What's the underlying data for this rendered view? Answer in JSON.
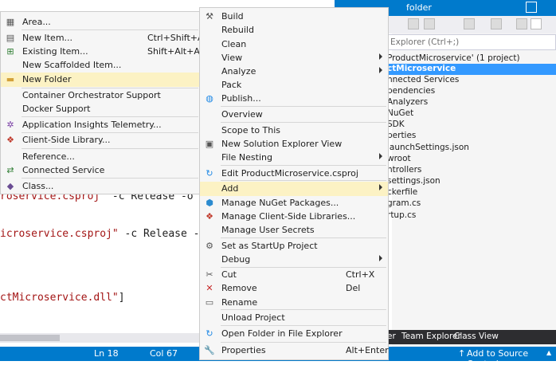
{
  "editor": {
    "lines": [
      {
        "str": "roservice.csproj\"",
        "rest": " -c Release -o /app"
      },
      {
        "str": "icroservice.csproj\"",
        "rest": " -c Release -o /app"
      },
      {
        "str": "ctMicroservice.dll\"",
        "rest": "]"
      }
    ]
  },
  "statusbar": {
    "line": "Ln 18",
    "col": "Col 67",
    "source_control": "Add to Source Control"
  },
  "solution_explorer": {
    "title": "folder",
    "search_placeholder": "Explorer (Ctrl+;)",
    "tree": [
      "ProductMicroservice' (1 project)",
      "ctMicroservice",
      "nnected Services",
      "pendencies",
      "Analyzers",
      "NuGet",
      "SDK",
      "perties",
      "launchSettings.json",
      "wroot",
      "ntrollers",
      "settings.json",
      "ckerfile",
      "gram.cs",
      "rtup.cs"
    ],
    "tabs": [
      "er",
      "Team Explorer",
      "Class View"
    ]
  },
  "add_menu": {
    "items": [
      {
        "label": "Area...",
        "shortcut": "",
        "icon": "area-icon"
      },
      {
        "label": "New Item...",
        "shortcut": "Ctrl+Shift+A",
        "icon": "new-item-icon"
      },
      {
        "label": "Existing Item...",
        "shortcut": "Shift+Alt+A",
        "icon": "existing-item-icon"
      },
      {
        "label": "New Scaffolded Item...",
        "shortcut": "",
        "icon": ""
      },
      {
        "label": "New Folder",
        "shortcut": "",
        "icon": "folder-icon"
      },
      {
        "label": "Container Orchestrator Support",
        "shortcut": "",
        "icon": ""
      },
      {
        "label": "Docker Support",
        "shortcut": "",
        "icon": ""
      },
      {
        "label": "Application Insights Telemetry...",
        "shortcut": "",
        "icon": "app-insights-icon"
      },
      {
        "label": "Client-Side Library...",
        "shortcut": "",
        "icon": "client-lib-icon"
      },
      {
        "label": "Reference...",
        "shortcut": "",
        "icon": ""
      },
      {
        "label": "Connected Service",
        "shortcut": "",
        "icon": "connected-service-icon"
      },
      {
        "label": "Class...",
        "shortcut": "",
        "icon": "class-icon"
      }
    ]
  },
  "project_menu": {
    "items": [
      {
        "label": "Build",
        "shortcut": ""
      },
      {
        "label": "Rebuild",
        "shortcut": ""
      },
      {
        "label": "Clean",
        "shortcut": ""
      },
      {
        "label": "View",
        "shortcut": ""
      },
      {
        "label": "Analyze",
        "shortcut": ""
      },
      {
        "label": "Pack",
        "shortcut": ""
      },
      {
        "label": "Publish...",
        "shortcut": ""
      },
      {
        "label": "Overview",
        "shortcut": ""
      },
      {
        "label": "Scope to This",
        "shortcut": ""
      },
      {
        "label": "New Solution Explorer View",
        "shortcut": ""
      },
      {
        "label": "File Nesting",
        "shortcut": ""
      },
      {
        "label": "Edit ProductMicroservice.csproj",
        "shortcut": ""
      },
      {
        "label": "Add",
        "shortcut": ""
      },
      {
        "label": "Manage NuGet Packages...",
        "shortcut": ""
      },
      {
        "label": "Manage Client-Side Libraries...",
        "shortcut": ""
      },
      {
        "label": "Manage User Secrets",
        "shortcut": ""
      },
      {
        "label": "Set as StartUp Project",
        "shortcut": ""
      },
      {
        "label": "Debug",
        "shortcut": ""
      },
      {
        "label": "Cut",
        "shortcut": "Ctrl+X"
      },
      {
        "label": "Remove",
        "shortcut": "Del"
      },
      {
        "label": "Rename",
        "shortcut": ""
      },
      {
        "label": "Unload Project",
        "shortcut": ""
      },
      {
        "label": "Open Folder in File Explorer",
        "shortcut": ""
      },
      {
        "label": "Properties",
        "shortcut": "Alt+Enter"
      }
    ]
  },
  "colors": {
    "accent": "#007acc",
    "highlight": "#fcf2c4",
    "selection": "#3399ff"
  }
}
